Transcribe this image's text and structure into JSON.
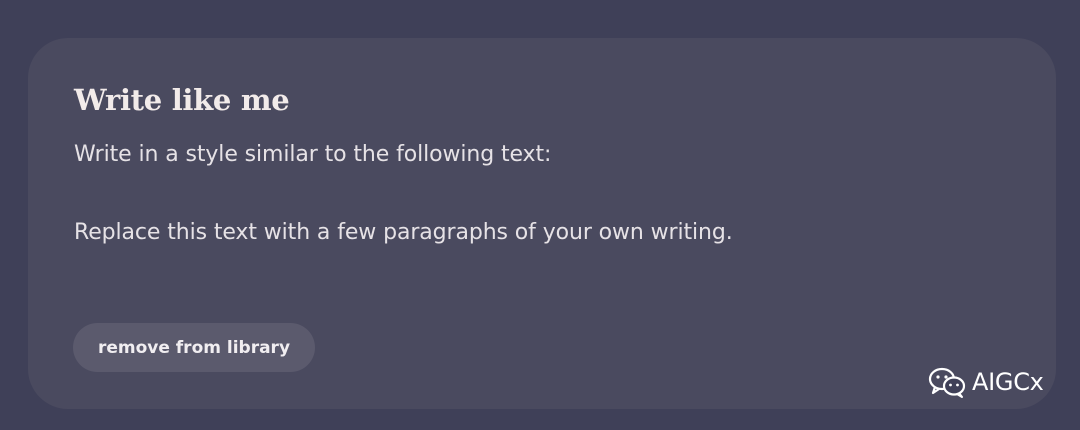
{
  "card": {
    "title": "Write like me",
    "prompt_lines": [
      "Write in a style similar to the following text:",
      "Replace this text with a few paragraphs of your own writing."
    ],
    "remove_button_label": "remove from library"
  },
  "watermark": {
    "icon": "wechat-icon",
    "text": "AIGCx"
  },
  "colors": {
    "page_background": "#3f4058",
    "card_background": "#4a4a5f",
    "button_background": "#5b5a6d",
    "title_text": "#f2ebea",
    "body_text": "#e6e2e6"
  }
}
